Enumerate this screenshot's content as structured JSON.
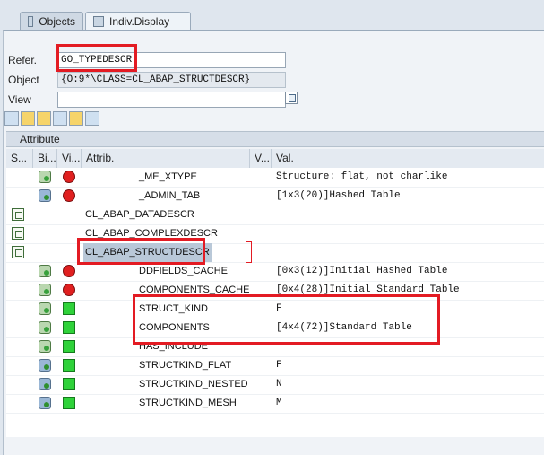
{
  "tabs": [
    {
      "label": "Objects"
    },
    {
      "label": "Indiv.Display"
    }
  ],
  "form": {
    "refer_label": "Refer.",
    "refer_value": "GO_TYPEDESCR",
    "object_label": "Object",
    "object_value": "{O:9*\\CLASS=CL_ABAP_STRUCTDESCR}",
    "view_label": "View",
    "view_value": ""
  },
  "section": {
    "title": "Attribute"
  },
  "columns": [
    "S...",
    "Bi...",
    "Vi...",
    "Attrib.",
    "V...",
    "Val."
  ],
  "rows": [
    {
      "attr": "_ME_XTYPE",
      "val": "Structure: flat, not charlike",
      "s": "",
      "bi": "obj-green",
      "vi": "red",
      "indent": 2
    },
    {
      "attr": "_ADMIN_TAB",
      "val": "[1x3(20)]Hashed Table",
      "s": "",
      "bi": "obj-blue",
      "vi": "red",
      "indent": 2
    },
    {
      "attr": "CL_ABAP_DATADESCR",
      "val": "",
      "s": "class",
      "bi": "",
      "vi": "",
      "indent": 0
    },
    {
      "attr": "CL_ABAP_COMPLEXDESCR",
      "val": "",
      "s": "class",
      "bi": "",
      "vi": "",
      "indent": 0
    },
    {
      "attr": "CL_ABAP_STRUCTDESCR",
      "val": "",
      "s": "class",
      "bi": "",
      "vi": "",
      "indent": 0,
      "selected": true
    },
    {
      "attr": "DDFIELDS_CACHE",
      "val": "[0x3(12)]Initial Hashed Table",
      "s": "",
      "bi": "obj-green",
      "vi": "red",
      "indent": 2
    },
    {
      "attr": "COMPONENTS_CACHE",
      "val": "[0x4(28)]Initial Standard Table",
      "s": "",
      "bi": "obj-green",
      "vi": "red",
      "indent": 2
    },
    {
      "attr": "STRUCT_KIND",
      "val": "F",
      "s": "",
      "bi": "obj-green",
      "vi": "green",
      "indent": 2
    },
    {
      "attr": "COMPONENTS",
      "val": "[4x4(72)]Standard Table",
      "s": "",
      "bi": "obj-green",
      "vi": "green",
      "indent": 2
    },
    {
      "attr": "HAS_INCLUDE",
      "val": "",
      "s": "",
      "bi": "obj-green",
      "vi": "green",
      "indent": 2
    },
    {
      "attr": "STRUCTKIND_FLAT",
      "val": "F",
      "s": "",
      "bi": "obj-blue",
      "vi": "green",
      "indent": 2
    },
    {
      "attr": "STRUCTKIND_NESTED",
      "val": "N",
      "s": "",
      "bi": "obj-blue",
      "vi": "green",
      "indent": 2
    },
    {
      "attr": "STRUCTKIND_MESH",
      "val": "M",
      "s": "",
      "bi": "obj-blue",
      "vi": "green",
      "indent": 2
    }
  ],
  "icons": {
    "toolbar": [
      "pin-icon",
      "refresh-icon",
      "expand-icon",
      "nav-icon",
      "tree-icon",
      "filter-icon"
    ]
  }
}
